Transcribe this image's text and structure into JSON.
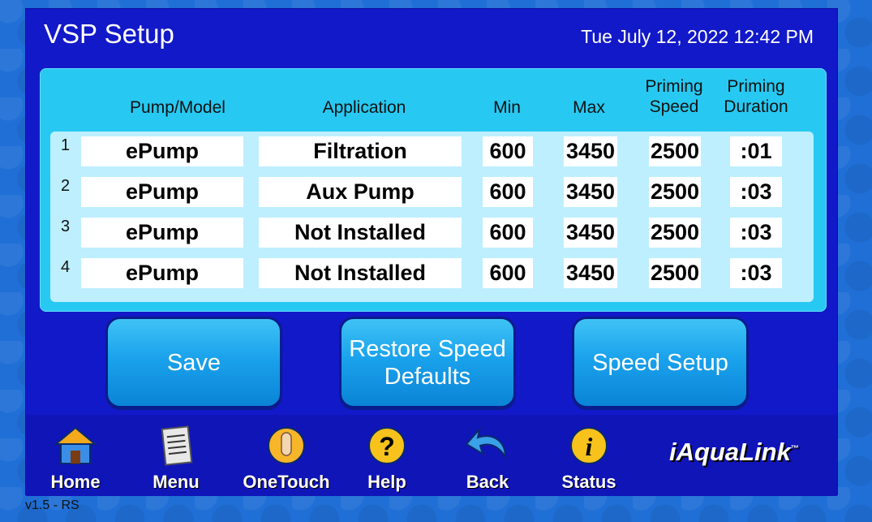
{
  "header": {
    "title": "VSP Setup",
    "datetime": "Tue July 12, 2022 12:42 PM"
  },
  "table": {
    "headers": {
      "pump_model": "Pump/Model",
      "application": "Application",
      "min": "Min",
      "max": "Max",
      "priming_speed_l1": "Priming",
      "priming_speed_l2": "Speed",
      "priming_duration_l1": "Priming",
      "priming_duration_l2": "Duration"
    },
    "rows": [
      {
        "num": "1",
        "pump": "ePump",
        "application": "Filtration",
        "min": "600",
        "max": "3450",
        "priming_speed": "2500",
        "priming_duration": ":01"
      },
      {
        "num": "2",
        "pump": "ePump",
        "application": "Aux Pump",
        "min": "600",
        "max": "3450",
        "priming_speed": "2500",
        "priming_duration": ":03"
      },
      {
        "num": "3",
        "pump": "ePump",
        "application": "Not Installed",
        "min": "600",
        "max": "3450",
        "priming_speed": "2500",
        "priming_duration": ":03"
      },
      {
        "num": "4",
        "pump": "ePump",
        "application": "Not Installed",
        "min": "600",
        "max": "3450",
        "priming_speed": "2500",
        "priming_duration": ":03"
      }
    ]
  },
  "buttons": {
    "save": "Save",
    "restore_l1": "Restore Speed",
    "restore_l2": "Defaults",
    "speed_setup": "Speed Setup"
  },
  "nav": [
    {
      "label": "Home",
      "icon": "home-icon"
    },
    {
      "label": "Menu",
      "icon": "menu-icon"
    },
    {
      "label": "OneTouch",
      "icon": "onetouch-icon"
    },
    {
      "label": "Help",
      "icon": "help-icon"
    },
    {
      "label": "Back",
      "icon": "back-icon"
    },
    {
      "label": "Status",
      "icon": "status-icon"
    }
  ],
  "brand": {
    "name": "iAquaLink",
    "tm": "™"
  },
  "version": "v1.5 - RS"
}
